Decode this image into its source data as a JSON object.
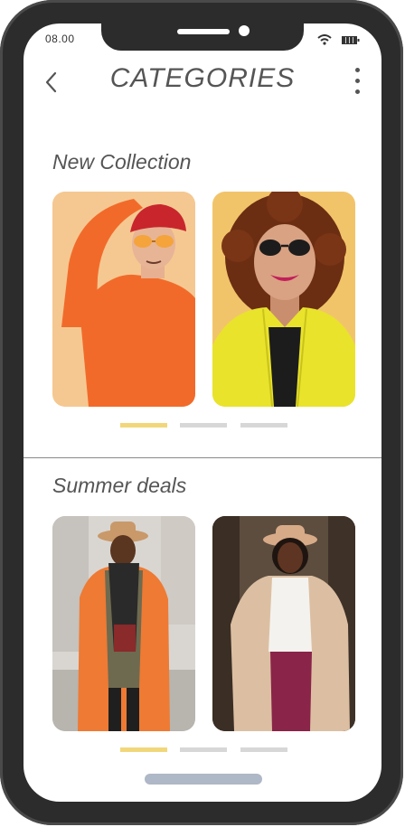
{
  "status": {
    "time": "08.00"
  },
  "header": {
    "title": "CATEGORIES"
  },
  "sections": [
    {
      "title": "New Collection",
      "items": [
        {
          "name": "man-orange-sweater-red-cap",
          "background": "#f4c48a"
        },
        {
          "name": "woman-yellow-jacket-curly-hair",
          "background": "#f2c46a"
        }
      ],
      "pager": {
        "count": 3,
        "active": 0
      }
    },
    {
      "title": "Summer deals",
      "items": [
        {
          "name": "man-orange-coat-fedora",
          "background": "#d8d8d8"
        },
        {
          "name": "woman-beige-coat-fedora",
          "background": "#5a4a3c"
        }
      ],
      "pager": {
        "count": 3,
        "active": 0
      }
    }
  ],
  "colors": {
    "text": "#555555",
    "pager_active": "#f2d77a",
    "pager_inactive": "#d7d7d7",
    "home_indicator": "#aeb8c6",
    "frame": "#2c2c2c"
  }
}
